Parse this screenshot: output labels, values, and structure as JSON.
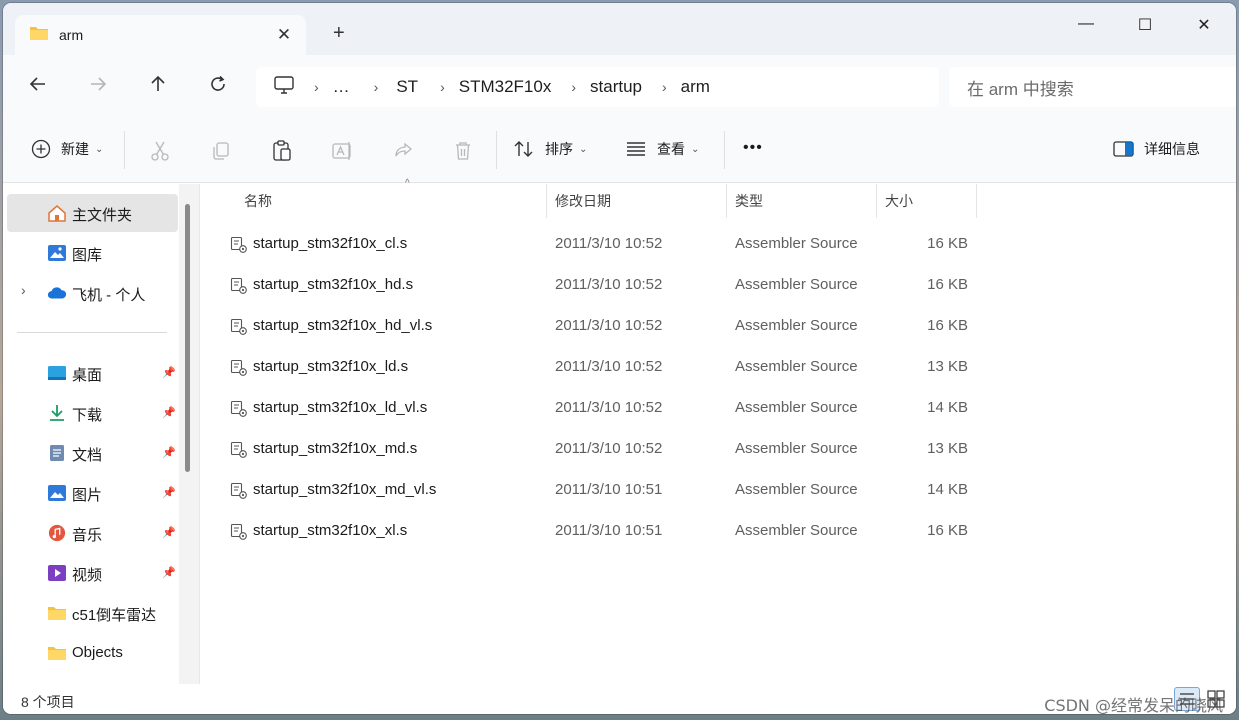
{
  "window": {
    "tab_title": "arm",
    "tab_close": "✕",
    "new_tab": "+"
  },
  "window_controls": {
    "minimize": "—",
    "maximize": "☐",
    "close": "✕"
  },
  "address": {
    "breadcrumbs": [
      "…",
      "ST",
      "STM32F10x",
      "startup",
      "arm"
    ],
    "separator": "›"
  },
  "search": {
    "placeholder": "在 arm 中搜索"
  },
  "toolbar": {
    "new_label": "新建",
    "sort_label": "排序",
    "view_label": "查看",
    "more_label": "•••",
    "details_label": "详细信息"
  },
  "sidebar": {
    "items": [
      {
        "label": "主文件夹",
        "icon": "home-icon"
      },
      {
        "label": "图库",
        "icon": "gallery-icon"
      },
      {
        "label": "飞机 - 个人",
        "icon": "onedrive-icon"
      },
      {
        "label": "桌面",
        "icon": "desktop-icon"
      },
      {
        "label": "下载",
        "icon": "download-icon"
      },
      {
        "label": "文档",
        "icon": "documents-icon"
      },
      {
        "label": "图片",
        "icon": "pictures-icon"
      },
      {
        "label": "音乐",
        "icon": "music-icon"
      },
      {
        "label": "视频",
        "icon": "videos-icon"
      },
      {
        "label": "c51倒车雷达",
        "icon": "folder-icon"
      },
      {
        "label": "Objects",
        "icon": "folder-icon"
      }
    ]
  },
  "columns": {
    "name": "名称",
    "date": "修改日期",
    "type": "类型",
    "size": "大小"
  },
  "files": [
    {
      "name": "startup_stm32f10x_cl.s",
      "date": "2011/3/10 10:52",
      "type": "Assembler Source",
      "size": "16 KB"
    },
    {
      "name": "startup_stm32f10x_hd.s",
      "date": "2011/3/10 10:52",
      "type": "Assembler Source",
      "size": "16 KB"
    },
    {
      "name": "startup_stm32f10x_hd_vl.s",
      "date": "2011/3/10 10:52",
      "type": "Assembler Source",
      "size": "16 KB"
    },
    {
      "name": "startup_stm32f10x_ld.s",
      "date": "2011/3/10 10:52",
      "type": "Assembler Source",
      "size": "13 KB"
    },
    {
      "name": "startup_stm32f10x_ld_vl.s",
      "date": "2011/3/10 10:52",
      "type": "Assembler Source",
      "size": "14 KB"
    },
    {
      "name": "startup_stm32f10x_md.s",
      "date": "2011/3/10 10:52",
      "type": "Assembler Source",
      "size": "13 KB"
    },
    {
      "name": "startup_stm32f10x_md_vl.s",
      "date": "2011/3/10 10:51",
      "type": "Assembler Source",
      "size": "14 KB"
    },
    {
      "name": "startup_stm32f10x_xl.s",
      "date": "2011/3/10 10:51",
      "type": "Assembler Source",
      "size": "16 KB"
    }
  ],
  "status": {
    "item_count": "8 个项目"
  },
  "watermark": "CSDN @经常发呆的晓风",
  "colors": {
    "accent": "#0067c0",
    "folder": "#f4c242",
    "selected_bg": "#e5e5e5"
  }
}
